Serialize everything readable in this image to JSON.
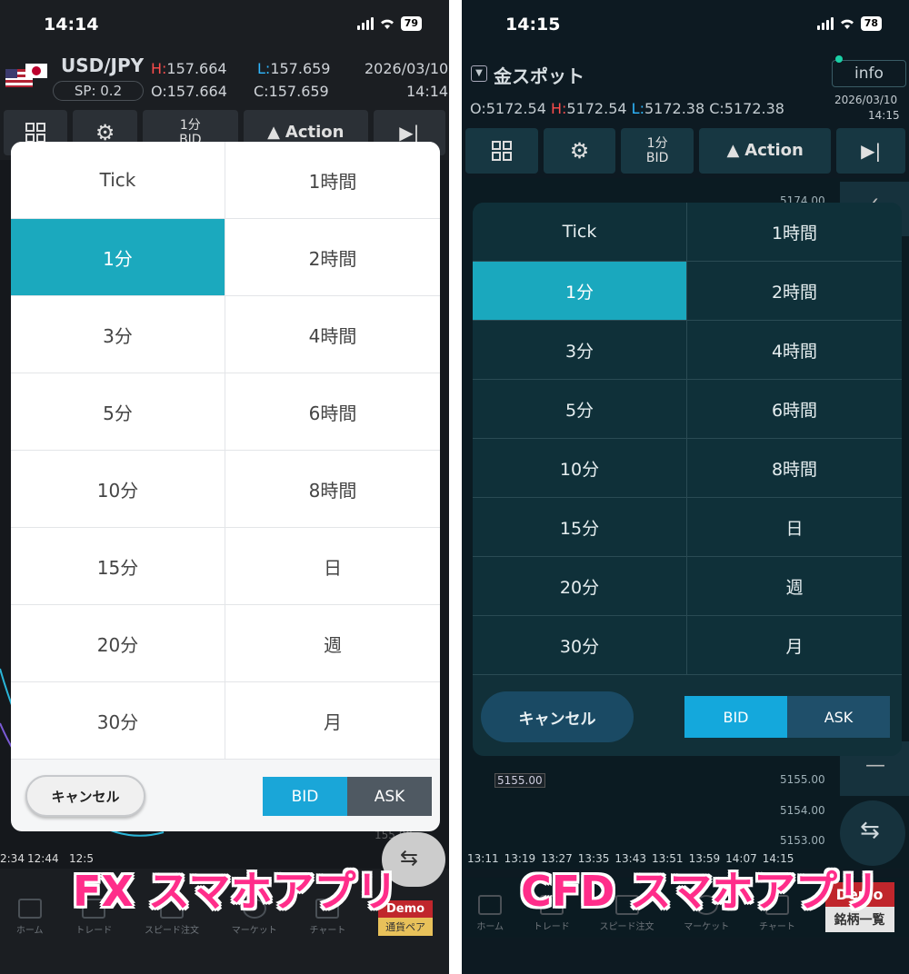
{
  "fx": {
    "status": {
      "time": "14:14",
      "battery": "79"
    },
    "header": {
      "pair": "USD/JPY",
      "sp": "SP: 0.2",
      "high_label": "H:",
      "high": "157.664",
      "low_label": "L:",
      "low": "157.659",
      "open_label": "O:",
      "open": "157.664",
      "close_label": "C:",
      "close": "157.659",
      "date": "2026/03/10",
      "time": "14:14"
    },
    "toolbar": {
      "interval_top": "1分",
      "interval_bottom": "BID",
      "action_label": "Action"
    },
    "chart": {
      "xticks": [
        "2:34",
        "12:44",
        "12:5"
      ],
      "price_frag": "155.00"
    },
    "modal": {
      "cells": [
        "Tick",
        "1時間",
        "1分",
        "2時間",
        "3分",
        "4時間",
        "5分",
        "6時間",
        "10分",
        "8時間",
        "15分",
        "日",
        "20分",
        "週",
        "30分",
        "月"
      ],
      "selected_index": 2,
      "cancel_label": "キャンセル",
      "bid_label": "BID",
      "ask_label": "ASK"
    },
    "nav": [
      "ホーム",
      "トレード",
      "スピード注文",
      "マーケット",
      "チャート"
    ],
    "demo_badge": "Demo",
    "pair_badge": "通貨ペア"
  },
  "cfd": {
    "status": {
      "time": "14:15",
      "battery": "78"
    },
    "header": {
      "symbol": "金スポット",
      "info_label": "info",
      "open_label": "O:",
      "open": "5172.54",
      "high_label": "H:",
      "high": "5172.54",
      "low_label": "L:",
      "low": "5172.38",
      "close_label": "C:",
      "close": "5172.38",
      "date": "2026/03/10",
      "time": "14:15"
    },
    "toolbar": {
      "interval_top": "1分",
      "interval_bottom": "BID",
      "action_label": "Action"
    },
    "chart": {
      "price_top": "5174.00",
      "price_marker": "5155.00",
      "yticks": [
        "5155.00",
        "5154.00",
        "5153.00"
      ],
      "xticks": [
        "13:11",
        "13:19",
        "13:27",
        "13:35",
        "13:43",
        "13:51",
        "13:59",
        "14:07",
        "14:15"
      ]
    },
    "modal": {
      "cells": [
        "Tick",
        "1時間",
        "1分",
        "2時間",
        "3分",
        "4時間",
        "5分",
        "6時間",
        "10分",
        "8時間",
        "15分",
        "日",
        "20分",
        "週",
        "30分",
        "月"
      ],
      "selected_index": 2,
      "cancel_label": "キャンセル",
      "bid_label": "BID",
      "ask_label": "ASK"
    },
    "nav": [
      "ホーム",
      "トレード",
      "スピード注文",
      "マーケット",
      "チャート"
    ],
    "demo_badge": "Demo",
    "list_badge": "銘柄一覧"
  },
  "captions": {
    "fx": "FX スマホアプリ",
    "cfd": "CFD スマホアプリ"
  }
}
